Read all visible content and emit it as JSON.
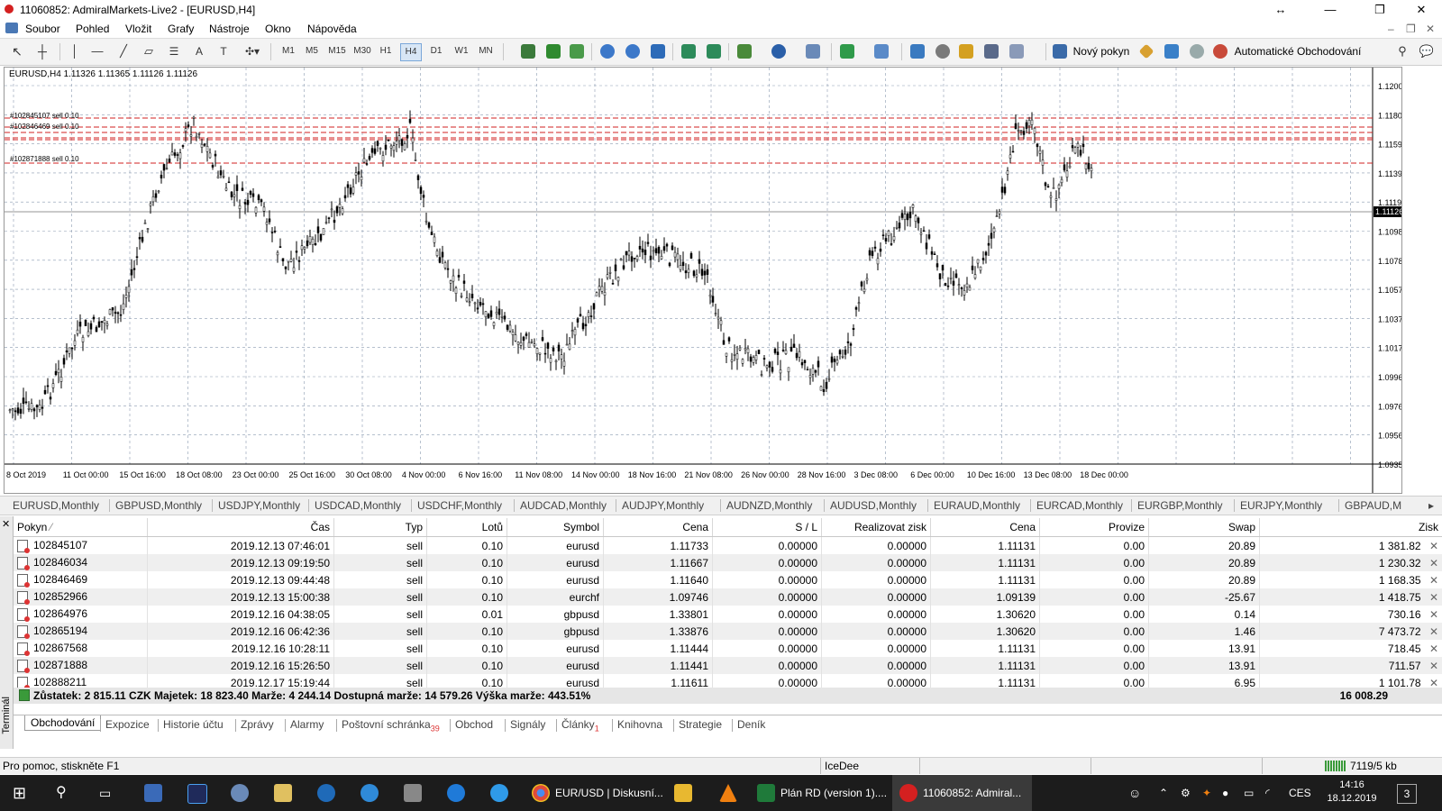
{
  "window": {
    "title": "11060852: AdmiralMarkets-Live2 - [EURUSD,H4]",
    "controls": [
      "↔",
      "—",
      "❐",
      "✕"
    ]
  },
  "menu": [
    "Soubor",
    "Pohled",
    "Vložit",
    "Grafy",
    "Nástroje",
    "Okno",
    "Nápověda"
  ],
  "toolbar": {
    "timeframes": [
      "M1",
      "M5",
      "M15",
      "M30",
      "H1",
      "H4",
      "D1",
      "W1",
      "MN"
    ],
    "new_order": "Nový pokyn",
    "auto_trading": "Automatické Obchodování"
  },
  "chart": {
    "symbol_line": "EURUSD,H4  1.11326 1.11365 1.11126 1.11126",
    "current_price": "1.11126",
    "order_lines": [
      "#102845107 sell 0.10",
      "#102846469 sell 0.10",
      "#102871888 sell 0.10"
    ],
    "price_ticks": [
      "1.12005",
      "1.11800",
      "1.11595",
      "1.11390",
      "1.11190",
      "1.10985",
      "1.10780",
      "1.10575",
      "1.10375",
      "1.10170",
      "1.09965",
      "1.09760",
      "1.09560",
      "1.09355"
    ],
    "date_ticks": [
      "8 Oct 2019",
      "11 Oct 00:00",
      "15 Oct 16:00",
      "18 Oct 08:00",
      "23 Oct 00:00",
      "25 Oct 16:00",
      "30 Oct 08:00",
      "4 Nov 00:00",
      "6 Nov 16:00",
      "11 Nov 08:00",
      "14 Nov 00:00",
      "18 Nov 16:00",
      "21 Nov 08:00",
      "26 Nov 00:00",
      "28 Nov 16:00",
      "3 Dec 08:00",
      "6 Dec 00:00",
      "10 Dec 16:00",
      "13 Dec 08:00",
      "18 Dec 00:00"
    ]
  },
  "symbol_tabs": [
    "EURUSD,Monthly",
    "GBPUSD,Monthly",
    "USDJPY,Monthly",
    "USDCAD,Monthly",
    "USDCHF,Monthly",
    "AUDCAD,Monthly",
    "AUDJPY,Monthly",
    "AUDNZD,Monthly",
    "AUDUSD,Monthly",
    "EURAUD,Monthly",
    "EURCAD,Monthly",
    "EURGBP,Monthly",
    "EURJPY,Monthly",
    "GBPAUD,M"
  ],
  "orders": {
    "columns": [
      "Pokyn",
      "Čas",
      "Typ",
      "Lotů",
      "Symbol",
      "Cena",
      "S / L",
      "Realizovat zisk",
      "Cena",
      "Provize",
      "Swap",
      "Zisk"
    ],
    "rows": [
      [
        "102845107",
        "2019.12.13 07:46:01",
        "sell",
        "0.10",
        "eurusd",
        "1.11733",
        "0.00000",
        "0.00000",
        "1.11131",
        "0.00",
        "20.89",
        "1 381.82"
      ],
      [
        "102846034",
        "2019.12.13 09:19:50",
        "sell",
        "0.10",
        "eurusd",
        "1.11667",
        "0.00000",
        "0.00000",
        "1.11131",
        "0.00",
        "20.89",
        "1 230.32"
      ],
      [
        "102846469",
        "2019.12.13 09:44:48",
        "sell",
        "0.10",
        "eurusd",
        "1.11640",
        "0.00000",
        "0.00000",
        "1.11131",
        "0.00",
        "20.89",
        "1 168.35"
      ],
      [
        "102852966",
        "2019.12.13 15:00:38",
        "sell",
        "0.10",
        "eurchf",
        "1.09746",
        "0.00000",
        "0.00000",
        "1.09139",
        "0.00",
        "-25.67",
        "1 418.75"
      ],
      [
        "102864976",
        "2019.12.16 04:38:05",
        "sell",
        "0.01",
        "gbpusd",
        "1.33801",
        "0.00000",
        "0.00000",
        "1.30620",
        "0.00",
        "0.14",
        "730.16"
      ],
      [
        "102865194",
        "2019.12.16 06:42:36",
        "sell",
        "0.10",
        "gbpusd",
        "1.33876",
        "0.00000",
        "0.00000",
        "1.30620",
        "0.00",
        "1.46",
        "7 473.72"
      ],
      [
        "102867568",
        "2019.12.16 10:28:11",
        "sell",
        "0.10",
        "eurusd",
        "1.11444",
        "0.00000",
        "0.00000",
        "1.11131",
        "0.00",
        "13.91",
        "718.45"
      ],
      [
        "102871888",
        "2019.12.16 15:26:50",
        "sell",
        "0.10",
        "eurusd",
        "1.11441",
        "0.00000",
        "0.00000",
        "1.11131",
        "0.00",
        "13.91",
        "711.57"
      ],
      [
        "102888211",
        "2019.12.17 15:19:44",
        "sell",
        "0.10",
        "eurusd",
        "1.11611",
        "0.00000",
        "0.00000",
        "1.11131",
        "0.00",
        "6.95",
        "1 101.78"
      ]
    ],
    "summary": "Zůstatek: 2 815.11 CZK  Majetek: 18 823.40  Marže: 4 244.14  Dostupná marže: 14 579.26  Výška marže: 443.51%",
    "total": "16 008.29"
  },
  "terminal_label": "Terminál",
  "bottom_tabs": [
    {
      "label": "Obchodování",
      "badge": ""
    },
    {
      "label": "Expozice",
      "badge": ""
    },
    {
      "label": "Historie účtu",
      "badge": ""
    },
    {
      "label": "Zprávy",
      "badge": ""
    },
    {
      "label": "Alarmy",
      "badge": ""
    },
    {
      "label": "Poštovní schránka",
      "badge": "39"
    },
    {
      "label": "Obchod",
      "badge": ""
    },
    {
      "label": "Signály",
      "badge": ""
    },
    {
      "label": "Články",
      "badge": "1"
    },
    {
      "label": "Knihovna",
      "badge": ""
    },
    {
      "label": "Strategie",
      "badge": ""
    },
    {
      "label": "Deník",
      "badge": ""
    }
  ],
  "status": {
    "help": "Pro pomoc, stiskněte F1",
    "profile": "IceDee",
    "connection": "7119/5 kb"
  },
  "taskbar": {
    "apps": [
      "EUR/USD | Diskusní...",
      "Plán RD (version 1)....",
      "11060852: Admiral..."
    ],
    "lang": "CES",
    "time": "14:16",
    "date": "18.12.2019",
    "notif": "3"
  }
}
